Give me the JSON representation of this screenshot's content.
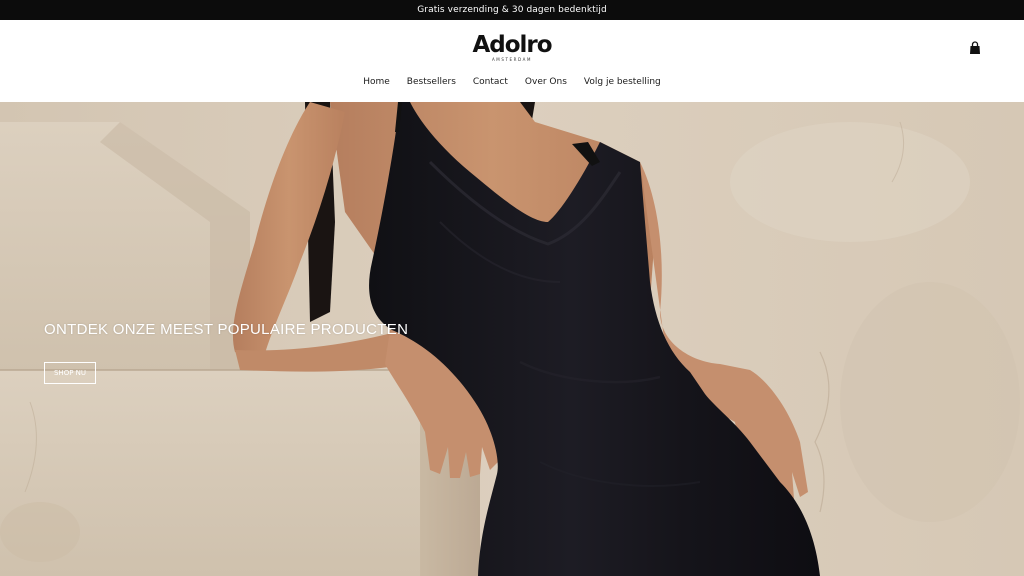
{
  "announcement": {
    "text": "Gratis verzending & 30 dagen bedenktijd"
  },
  "header": {
    "logo_text": "Adolro",
    "logo_subtext": "AMSTERDAM",
    "cart_icon": "shopping-bag-icon"
  },
  "nav": {
    "items": [
      {
        "label": "Home"
      },
      {
        "label": "Bestsellers"
      },
      {
        "label": "Contact"
      },
      {
        "label": "Over Ons"
      },
      {
        "label": "Volg je bestelling"
      }
    ]
  },
  "hero": {
    "title": "ONTDEK ONZE MEEST POPULAIRE PRODUCTEN",
    "button_label": "SHOP NU",
    "colors": {
      "wall": "#d8cbb9",
      "dress": "#15141a",
      "skin": "#c58f6e"
    }
  },
  "colors": {
    "announcement_bg": "#0c0c0c",
    "header_bg": "#ffffff",
    "text": "#1a1a1a"
  }
}
